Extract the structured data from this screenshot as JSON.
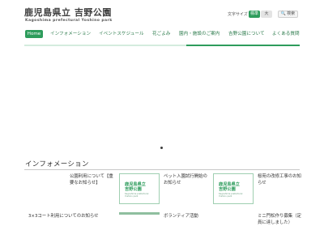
{
  "header": {
    "title": "鹿児島県立 吉野公園",
    "subtitle": "Kagoshima prefectural Yoshino park",
    "font_size_label": "文字サイズ",
    "font_size_options": [
      "標準",
      "大"
    ],
    "search_label": "検索"
  },
  "nav": {
    "items": [
      "Home",
      "インフォメーション",
      "イベントスケジュール",
      "花ごよみ",
      "園内・施設のご案内",
      "吉野公園について",
      "よくある質問"
    ]
  },
  "info": {
    "heading": "インフォメーション",
    "items": [
      {
        "line1": "公園利用について【重",
        "line2": "要なお知らせ】"
      },
      {
        "line1": "ペット入園試行開始の",
        "line2": "お知らせ"
      },
      {
        "line1": "桜苑の改修工事のお知",
        "line2": "らせ"
      },
      {
        "line1": "3×3コート利用についてのお知らせ",
        "line2": ""
      },
      {
        "line1": "ボランティア活動",
        "line2": ""
      },
      {
        "line1": "ミニ門松作り募集（定",
        "line2": "員に達しました）"
      }
    ],
    "thumb": {
      "logo_line1": "鹿児島県立",
      "logo_line2": "吉野公園",
      "sub_line1": "Kagoshima prefectural",
      "sub_line2": "Yoshino park"
    }
  },
  "colors": {
    "accent": "#2e9c5c",
    "nav_text": "#2b7a4b"
  }
}
